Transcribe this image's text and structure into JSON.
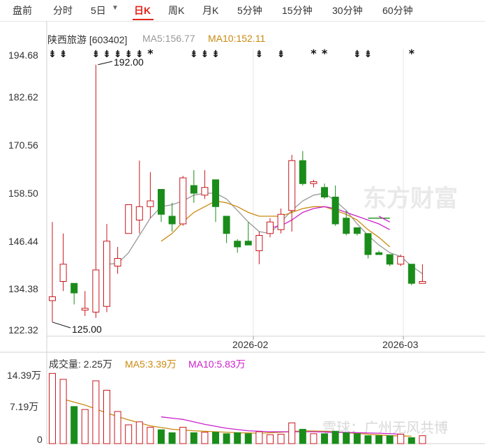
{
  "tabs": [
    {
      "label": "盘前",
      "active": false
    },
    {
      "label": "分时",
      "active": false
    },
    {
      "label": "5日",
      "active": false
    },
    {
      "label": "日K",
      "active": true
    },
    {
      "label": "周K",
      "active": false
    },
    {
      "label": "月K",
      "active": false
    },
    {
      "label": "5分钟",
      "active": false
    },
    {
      "label": "15分钟",
      "active": false
    },
    {
      "label": "30分钟",
      "active": false
    },
    {
      "label": "60分钟",
      "active": false
    }
  ],
  "chart_dropdown_icon": "chevron-down-icon",
  "legend": {
    "stock": "陕西旅游 [603402]",
    "ma5": "MA5:156.77",
    "ma10": "MA10:152.11"
  },
  "price_axis": [
    "194.68",
    "182.62",
    "170.56",
    "158.50",
    "146.44",
    "134.38",
    "122.32"
  ],
  "annotations": {
    "high": "192.00",
    "low": "125.00"
  },
  "x_axis": [
    "2026-02",
    "2026-03"
  ],
  "volume": {
    "title": "成交量: 2.25万",
    "ma5": "MA5:3.39万",
    "ma10": "MA10:5.83万",
    "axis": [
      "14.39万",
      "7.19万",
      "0"
    ]
  },
  "watermark": "东方财富",
  "credit": "雪球：广州无风共博",
  "colors": {
    "up": "#c8181e",
    "down": "#1a8c1a",
    "ma5": "#c98a0e",
    "ma10": "#cc20cc",
    "ma_gray": "#999999",
    "accent": "#e2231a"
  },
  "chart_data": {
    "type": "candlestick",
    "title": "陕西旅游 [603402]",
    "ylim": [
      122.32,
      194.68
    ],
    "candles": [
      {
        "o": 130.5,
        "h": 151.0,
        "l": 124.9,
        "c": 131.5
      },
      {
        "o": 135.5,
        "h": 148.0,
        "l": 133.0,
        "c": 140.0
      },
      {
        "o": 135.0,
        "h": 135.0,
        "l": 129.5,
        "c": 132.5
      },
      {
        "o": 128.0,
        "h": 133.0,
        "l": 126.5,
        "c": 128.5
      },
      {
        "o": 127.5,
        "h": 192.0,
        "l": 126.0,
        "c": 138.5
      },
      {
        "o": 129.0,
        "h": 150.5,
        "l": 127.5,
        "c": 146.0
      },
      {
        "o": 139.5,
        "h": 144.5,
        "l": 137.5,
        "c": 141.5
      },
      {
        "o": 148.0,
        "h": 155.5,
        "l": 148.0,
        "c": 155.5
      },
      {
        "o": 151.5,
        "h": 167.0,
        "l": 148.0,
        "c": 155.0
      },
      {
        "o": 155.0,
        "h": 164.0,
        "l": 152.0,
        "c": 156.5
      },
      {
        "o": 159.5,
        "h": 159.5,
        "l": 151.0,
        "c": 153.0
      },
      {
        "o": 152.5,
        "h": 156.0,
        "l": 148.5,
        "c": 150.5
      },
      {
        "o": 150.5,
        "h": 163.0,
        "l": 150.0,
        "c": 162.5
      },
      {
        "o": 160.5,
        "h": 164.5,
        "l": 156.0,
        "c": 158.5
      },
      {
        "o": 158.0,
        "h": 164.5,
        "l": 157.0,
        "c": 160.0
      },
      {
        "o": 162.0,
        "h": 162.0,
        "l": 151.0,
        "c": 155.0
      },
      {
        "o": 152.5,
        "h": 152.5,
        "l": 145.5,
        "c": 148.0
      },
      {
        "o": 146.0,
        "h": 146.5,
        "l": 143.0,
        "c": 144.5
      },
      {
        "o": 146.0,
        "h": 151.0,
        "l": 145.0,
        "c": 145.0
      },
      {
        "o": 143.5,
        "h": 148.5,
        "l": 140.0,
        "c": 147.5
      },
      {
        "o": 148.0,
        "h": 152.0,
        "l": 147.0,
        "c": 151.0
      },
      {
        "o": 149.0,
        "h": 154.5,
        "l": 148.0,
        "c": 153.0
      },
      {
        "o": 154.0,
        "h": 168.5,
        "l": 148.5,
        "c": 167.0
      },
      {
        "o": 167.0,
        "h": 169.5,
        "l": 160.5,
        "c": 161.0
      },
      {
        "o": 161.0,
        "h": 162.0,
        "l": 160.0,
        "c": 161.5
      },
      {
        "o": 160.0,
        "h": 161.0,
        "l": 157.0,
        "c": 157.5
      },
      {
        "o": 157.5,
        "h": 160.5,
        "l": 150.0,
        "c": 150.5
      },
      {
        "o": 152.0,
        "h": 154.0,
        "l": 147.5,
        "c": 148.0
      },
      {
        "o": 149.5,
        "h": 149.5,
        "l": 147.5,
        "c": 148.0
      },
      {
        "o": 148.0,
        "h": 148.0,
        "l": 141.5,
        "c": 142.5
      },
      {
        "o": 143.0,
        "h": 143.5,
        "l": 142.5,
        "c": 142.5
      },
      {
        "o": 142.5,
        "h": 142.5,
        "l": 139.5,
        "c": 140.0
      },
      {
        "o": 140.0,
        "h": 142.5,
        "l": 139.5,
        "c": 142.0
      },
      {
        "o": 140.0,
        "h": 140.0,
        "l": 134.5,
        "c": 135.0
      },
      {
        "o": 135.0,
        "h": 140.0,
        "l": 135.0,
        "c": 135.5
      }
    ],
    "ma_gray": [
      [
        5,
        140
      ],
      [
        6,
        140.2
      ],
      [
        7,
        143
      ],
      [
        8,
        147.5
      ],
      [
        9,
        152
      ],
      [
        10,
        155
      ],
      [
        11,
        155.5
      ],
      [
        12,
        156.5
      ],
      [
        13,
        158
      ],
      [
        14,
        158.5
      ],
      [
        15,
        158.5
      ],
      [
        16,
        157
      ],
      [
        17,
        154
      ],
      [
        18,
        151
      ],
      [
        19,
        148.5
      ],
      [
        20,
        148
      ],
      [
        21,
        151
      ],
      [
        22,
        154
      ],
      [
        23,
        156.5
      ],
      [
        24,
        158
      ],
      [
        25,
        158.5
      ],
      [
        26,
        156.5
      ],
      [
        27,
        154
      ],
      [
        28,
        150.5
      ],
      [
        29,
        147.5
      ],
      [
        30,
        145
      ],
      [
        31,
        143
      ],
      [
        32,
        142
      ],
      [
        33,
        139.5
      ],
      [
        34,
        137.5
      ]
    ],
    "ma5_line": [
      [
        10,
        146
      ],
      [
        11,
        148
      ],
      [
        12,
        151
      ],
      [
        13,
        153.5
      ],
      [
        14,
        155
      ],
      [
        15,
        156.5
      ],
      [
        16,
        156
      ],
      [
        17,
        155
      ],
      [
        18,
        153.5
      ],
      [
        19,
        152.5
      ],
      [
        20,
        152.5
      ],
      [
        21,
        152.5
      ],
      [
        22,
        153.5
      ],
      [
        23,
        154.5
      ],
      [
        24,
        155
      ],
      [
        25,
        155
      ],
      [
        26,
        154
      ],
      [
        27,
        153
      ],
      [
        28,
        151.5
      ],
      [
        29,
        149
      ],
      [
        30,
        147
      ],
      [
        31,
        144.5
      ]
    ],
    "ma10_line": [
      [
        20,
        149.5
      ],
      [
        21,
        150
      ],
      [
        22,
        151.5
      ],
      [
        23,
        153.5
      ],
      [
        24,
        154.5
      ],
      [
        25,
        155
      ],
      [
        26,
        154.5
      ],
      [
        27,
        153.5
      ],
      [
        28,
        152.5
      ],
      [
        29,
        151.5
      ],
      [
        30,
        150.5
      ],
      [
        31,
        149
      ]
    ],
    "ma_green": [
      [
        29,
        152
      ],
      [
        31,
        152
      ]
    ],
    "ma_extra_pink": [
      [
        30,
        152.5
      ],
      [
        31,
        151
      ]
    ],
    "volume_max": 14.39,
    "volumes": [
      14.2,
      13.0,
      7.5,
      6.9,
      12.7,
      10.8,
      6.5,
      3.8,
      4.4,
      3.3,
      2.8,
      2.2,
      3.3,
      2.2,
      2.3,
      2.3,
      2.0,
      2.2,
      2.0,
      2.4,
      1.8,
      1.9,
      4.2,
      2.9,
      2.0,
      2.0,
      2.5,
      2.2,
      2.0,
      1.6,
      1.6,
      1.6,
      1.9,
      1.2,
      1.6
    ],
    "vol_ma5": [
      [
        1,
        9.0
      ],
      [
        3,
        7.8
      ],
      [
        5,
        6.2
      ],
      [
        7,
        4.8
      ],
      [
        9,
        3.6
      ],
      [
        11,
        2.9
      ],
      [
        13,
        2.6
      ],
      [
        15,
        2.4
      ],
      [
        17,
        2.2
      ],
      [
        19,
        2.1
      ],
      [
        21,
        2.3
      ],
      [
        23,
        2.6
      ],
      [
        25,
        2.5
      ],
      [
        27,
        2.2
      ],
      [
        29,
        1.9
      ],
      [
        31,
        1.6
      ],
      [
        33,
        1.5
      ]
    ],
    "vol_ma10": [
      [
        10,
        5.4
      ],
      [
        12,
        4.9
      ],
      [
        14,
        3.9
      ],
      [
        16,
        3.1
      ],
      [
        18,
        2.6
      ],
      [
        20,
        2.4
      ],
      [
        22,
        2.4
      ],
      [
        24,
        2.4
      ],
      [
        26,
        2.3
      ],
      [
        28,
        2.2
      ],
      [
        30,
        2.1
      ],
      [
        32,
        1.9
      ]
    ],
    "markers": [
      0,
      1,
      4,
      5,
      6,
      7,
      8,
      9,
      13,
      14,
      15,
      19,
      21,
      24,
      25,
      28,
      29,
      33
    ],
    "marker_star": [
      9,
      24,
      25,
      33
    ]
  }
}
